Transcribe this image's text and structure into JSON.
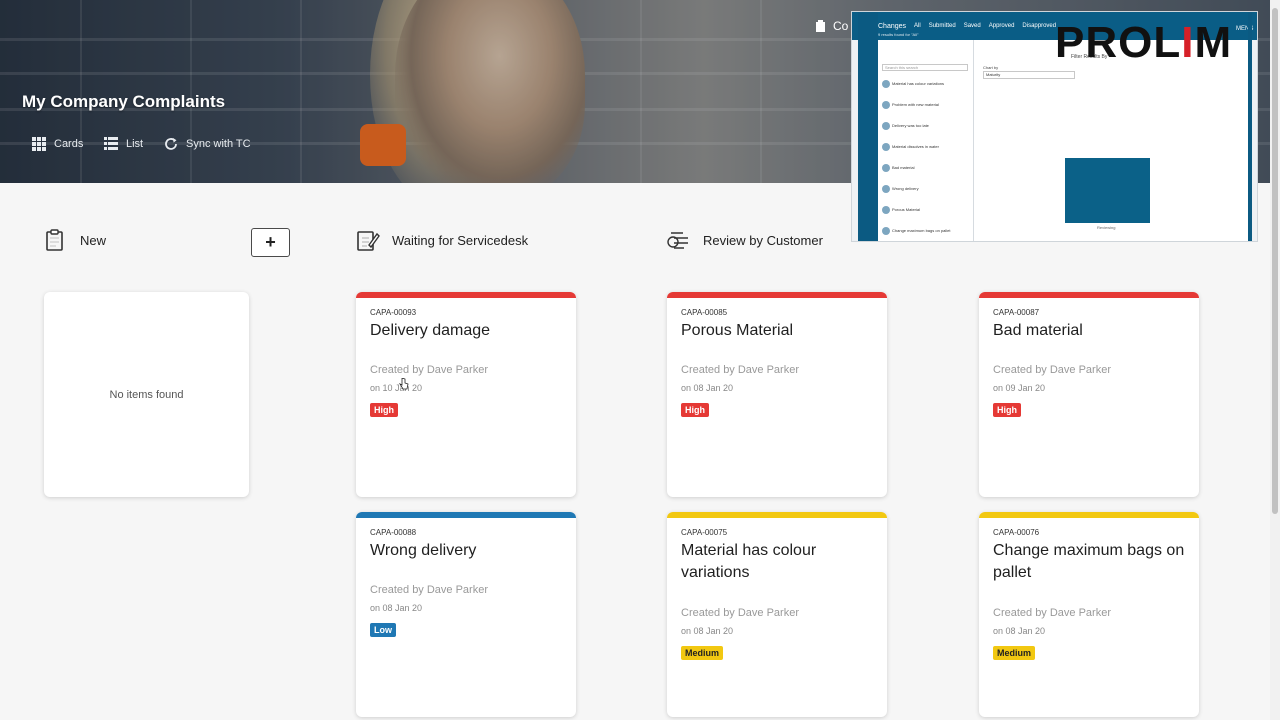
{
  "app": {
    "title": "My Company Complaints",
    "top_fragment": "Co"
  },
  "toolbar": {
    "cards_label": "Cards",
    "list_label": "List",
    "sync_label": "Sync with TC"
  },
  "columns": [
    {
      "name": "New",
      "icon": "clipboard-icon"
    },
    {
      "name": "Waiting for Servicedesk",
      "icon": "edit-document-icon"
    },
    {
      "name": "Review by Customer",
      "icon": "review-list-icon"
    }
  ],
  "add_button_label": "+",
  "empty_text": "No items found",
  "cards": [
    {
      "id": "CAPA-00093",
      "title": "Delivery damage",
      "created_by": "Created by Dave Parker",
      "date": "on 10 Jan 20",
      "priority": "High",
      "color": "#e53935"
    },
    {
      "id": "CAPA-00088",
      "title": "Wrong delivery",
      "created_by": "Created by Dave Parker",
      "date": "on 08 Jan 20",
      "priority": "Low",
      "color": "#1f78b4"
    },
    {
      "id": "CAPA-00085",
      "title": "Porous Material",
      "created_by": "Created by Dave Parker",
      "date": "on 08 Jan 20",
      "priority": "High",
      "color": "#e53935"
    },
    {
      "id": "CAPA-00075",
      "title": "Material has colour variations",
      "created_by": "Created by Dave Parker",
      "date": "on 08 Jan 20",
      "priority": "Medium",
      "color": "#f2c811"
    },
    {
      "id": "CAPA-00087",
      "title": "Bad material",
      "created_by": "Created by Dave Parker",
      "date": "on 09 Jan 20",
      "priority": "High",
      "color": "#e53935"
    },
    {
      "id": "CAPA-00076",
      "title": "Change maximum bags on pallet",
      "created_by": "Created by Dave Parker",
      "date": "on 08 Jan 20",
      "priority": "Medium",
      "color": "#f2c811"
    }
  ],
  "overlay": {
    "tabs": [
      "Changes",
      "All",
      "Submitted",
      "Saved",
      "Approved",
      "Disapproved"
    ],
    "results": "9 results found for \"All\"",
    "search_placeholder": "Search this search",
    "filter_title": "Filter Results By",
    "chart_by_label": "Chart by",
    "chart_by_value": "Maturity",
    "brand_fragment": "MENS",
    "bar_label": "Reviewing",
    "items": [
      "Material has colour variations",
      "Problem with new material",
      "Delivery was too late",
      "Material dissolves in water",
      "Bad material",
      "Wrong delivery",
      "Porous Material",
      "Change maximum bags on pallet"
    ]
  },
  "logo": {
    "text_a": "PROL",
    "text_b": "I",
    "text_c": "M"
  }
}
